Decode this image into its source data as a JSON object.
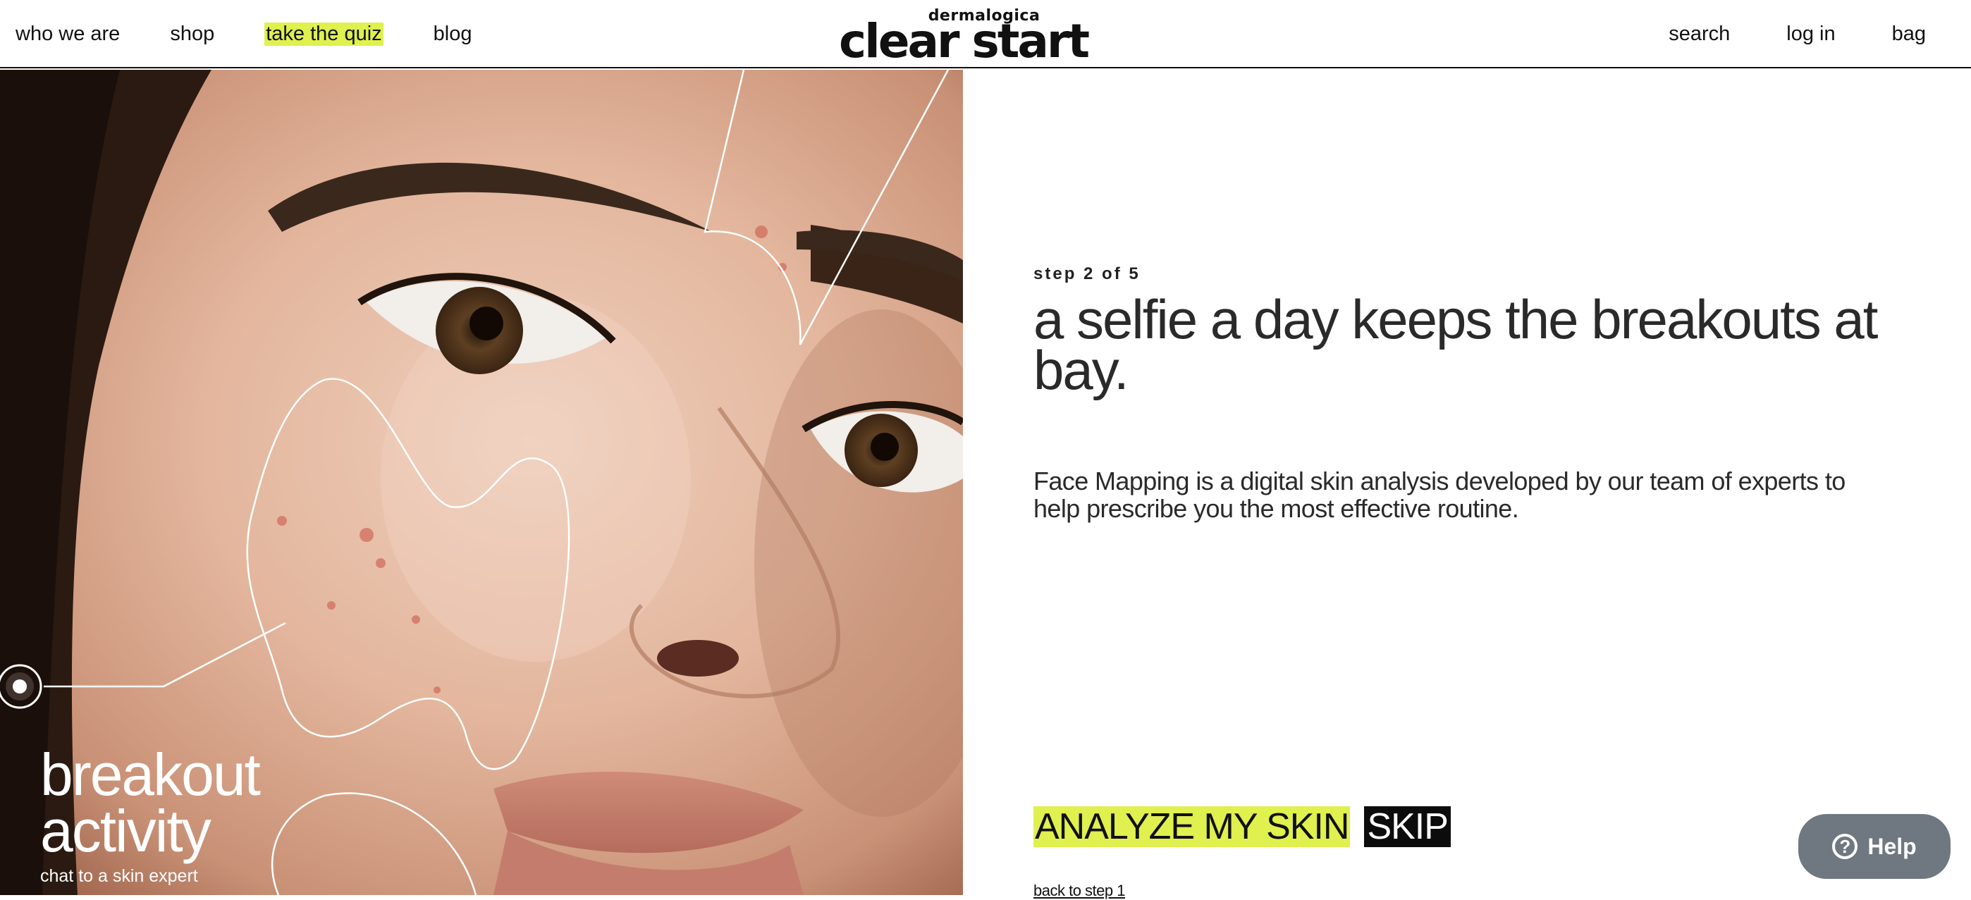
{
  "header": {
    "nav_left": [
      {
        "label": "who we are"
      },
      {
        "label": "shop"
      },
      {
        "label": "take the quiz",
        "highlight": "#dff04f"
      },
      {
        "label": "blog"
      }
    ],
    "logo": {
      "brand": "dermalogica",
      "product": "clear start"
    },
    "nav_right": [
      {
        "label": "search"
      },
      {
        "label": "log in"
      },
      {
        "label": "bag"
      }
    ]
  },
  "hero_image": {
    "zone_label": "breakout activity",
    "zone_link": "chat to a skin expert",
    "icon": "target-dot-icon"
  },
  "main": {
    "step": "step 2 of 5",
    "heading": "a selfie a day keeps the breakouts at bay.",
    "description": "Face Mapping is a digital skin analysis developed by our team of experts to help prescribe you the most effective routine.",
    "primary_button": "ANALYZE MY SKIN",
    "secondary_button": "SKIP",
    "back_link": "back to step 1"
  },
  "help": {
    "label": "Help",
    "icon": "question-circle-icon"
  },
  "colors": {
    "accent": "#dff04f",
    "dark": "#0c0c0c",
    "help_bg": "#6f7881"
  }
}
